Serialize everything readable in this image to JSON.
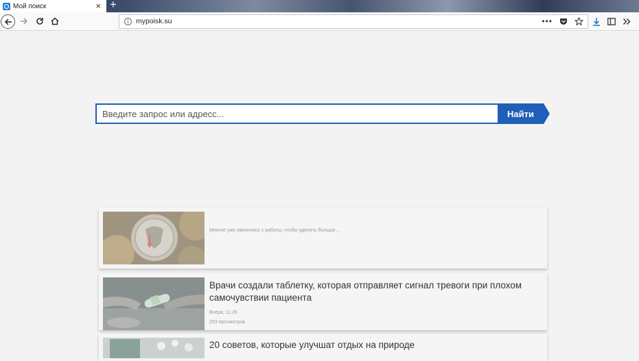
{
  "tab": {
    "title": "Мой поиск",
    "close": "×",
    "new_tab": "+"
  },
  "toolbar": {
    "url": "mypoisk.su",
    "info_icon": "i"
  },
  "search": {
    "placeholder": "Введите запрос или адресс...",
    "button": "Найти"
  },
  "news": [
    {
      "snippet": "Многие уже уволились с работы, чтобы уделять больше ...",
      "image": "coins-photo"
    },
    {
      "title_line1": "Врачи создали таблетку, которая отправляет сигнал тревоги при плохом",
      "title_line2": "самочувствии пациента",
      "date": "Вчера, 11:26",
      "views": "293 просмотров",
      "image": "pill-hands-photo"
    },
    {
      "title": "20 советов, которые улучшат отдых на природе",
      "image": "pills-photo"
    }
  ],
  "colors": {
    "accent": "#1f5fb8"
  }
}
